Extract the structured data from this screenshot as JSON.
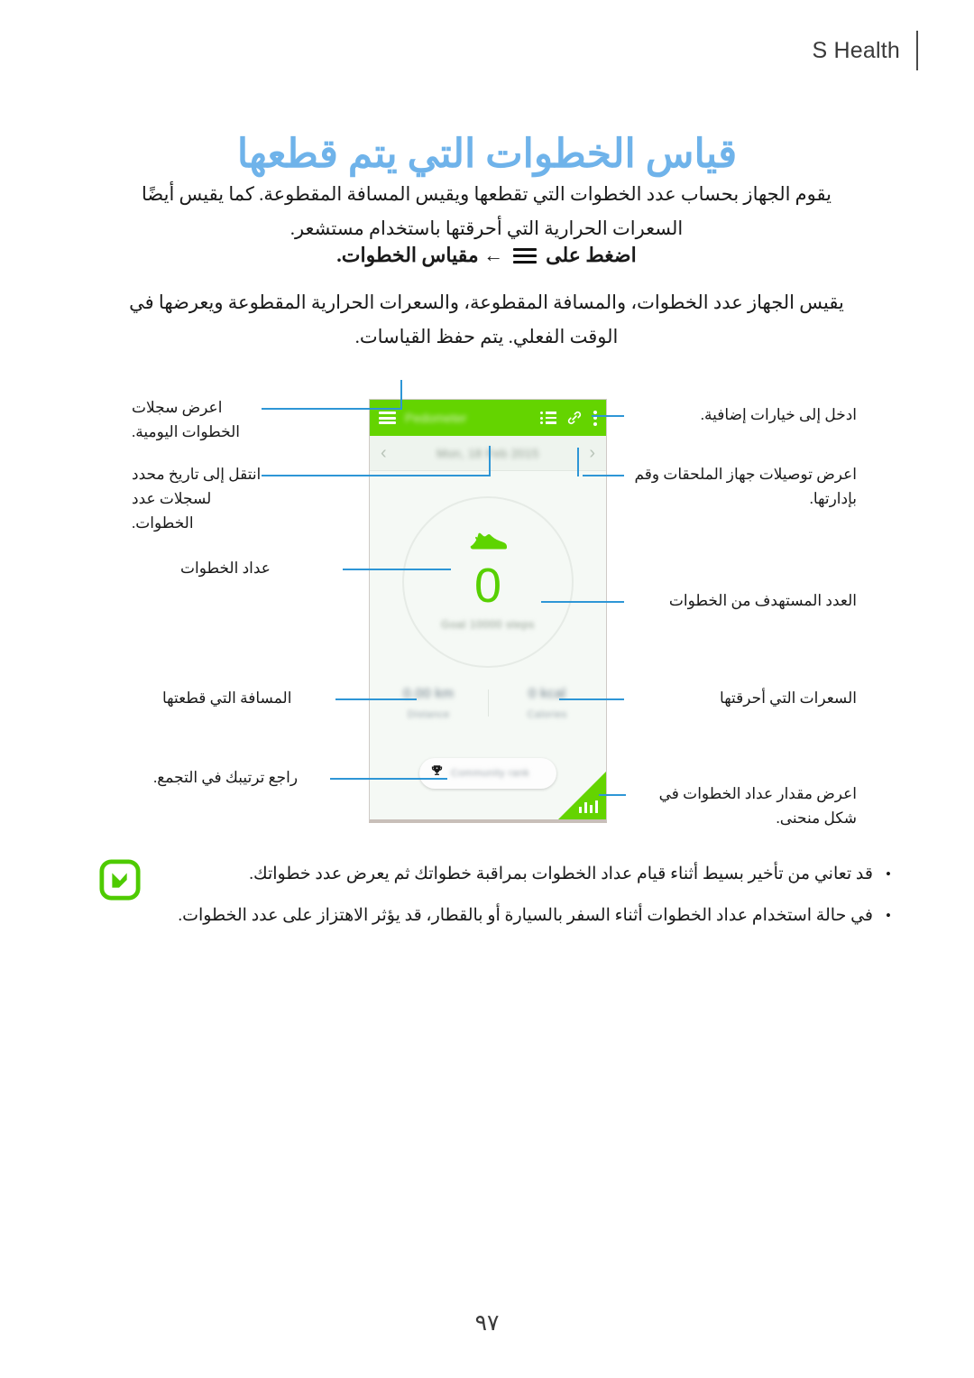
{
  "header": {
    "title": "S Health"
  },
  "page": {
    "title": "قياس الخطوات التي يتم قطعها",
    "number": "٩٧"
  },
  "intro": {
    "paragraph": "يقوم الجهاز بحساب عدد الخطوات التي تقطعها ويقيس المسافة المقطوعة. كما يقيس أيضًا السعرات الحرارية التي أحرقتها باستخدام مستشعر.",
    "step_prefix": "اضغط على",
    "step_icon": "hamburger-menu-icon",
    "step_arrow": "←",
    "step_target": "مقياس الخطوات.",
    "secondary_paragraph": "يقيس الجهاز عدد الخطوات، والمسافة المقطوعة، والسعرات الحرارية المقطوعة ويعرضها في الوقت الفعلي. يتم حفظ القياسات."
  },
  "phone": {
    "topbar": {
      "menu_icon": "hamburger-menu-icon",
      "title": "Pedometer",
      "list_icon": "list-records-icon",
      "link_icon": "accessory-link-icon",
      "more_icon": "more-options-icon"
    },
    "datebar": {
      "prev_icon": "chevron-left-icon",
      "date": "Mon, 18 Feb 2015",
      "next_icon": "chevron-right-icon"
    },
    "ring": {
      "shoe_icon": "running-shoe-icon",
      "steps": "0",
      "goal": "Goal 10000 steps"
    },
    "stats": [
      {
        "value": "0.00 km",
        "label": "Distance"
      },
      {
        "value": "0 kcal",
        "label": "Calories"
      }
    ],
    "badge": {
      "trophy_icon": "trophy-icon",
      "text": "Community rank"
    },
    "corner": {
      "chart_icon": "bar-chart-icon"
    }
  },
  "callouts": {
    "left": [
      "اعرض سجلات الخطوات اليومية.",
      "انتقل إلى تاريخ محدد لسجلات عدد الخطوات.",
      "عداد الخطوات",
      "المسافة التي قطعتها",
      "راجع ترتيبك في التجمع."
    ],
    "right": [
      "ادخل إلى خيارات إضافية.",
      "اعرض توصيلات جهاز الملحقات وقم بإدارتها.",
      "العدد المستهدف من الخطوات",
      "السعرات التي أحرقتها",
      "اعرض مقدار عداد الخطوات في شكل منحنى."
    ]
  },
  "notes": {
    "icon": "note-pencil-icon",
    "items": [
      "قد تعاني من تأخير بسيط أثناء قيام عداد الخطوات بمراقبة خطواتك ثم يعرض عدد خطواتك.",
      "في حالة استخدام عداد الخطوات أثناء السفر بالسيارة أو بالقطار، قد يؤثر الاهتزاز على عدد الخطوات."
    ]
  },
  "colors": {
    "accent_green": "#64d400",
    "title_blue": "#6fb3ea",
    "leader_blue": "#2e96d6"
  }
}
